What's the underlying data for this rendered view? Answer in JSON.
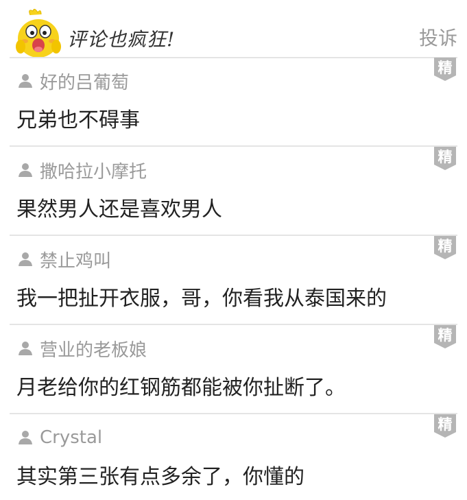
{
  "header": {
    "title": "评论也疯狂!",
    "report_label": "投诉"
  },
  "badge_label": "精",
  "comments": [
    {
      "username": "好的吕葡萄",
      "text": "兄弟也不碍事"
    },
    {
      "username": "撒哈拉小摩托",
      "text": "果然男人还是喜欢男人"
    },
    {
      "username": "禁止鸡叫",
      "text": "我一把扯开衣服，哥，你看我从泰国来的"
    },
    {
      "username": "营业的老板娘",
      "text": "月老给你的红钢筋都能被你扯断了。"
    },
    {
      "username": "Crystal",
      "text": "其实第三张有点多余了，你懂的"
    }
  ],
  "colors": {
    "badge": "#b5b5b5",
    "mascot": "#f7d21c",
    "text": "#222222",
    "meta": "#9a9a9a"
  }
}
